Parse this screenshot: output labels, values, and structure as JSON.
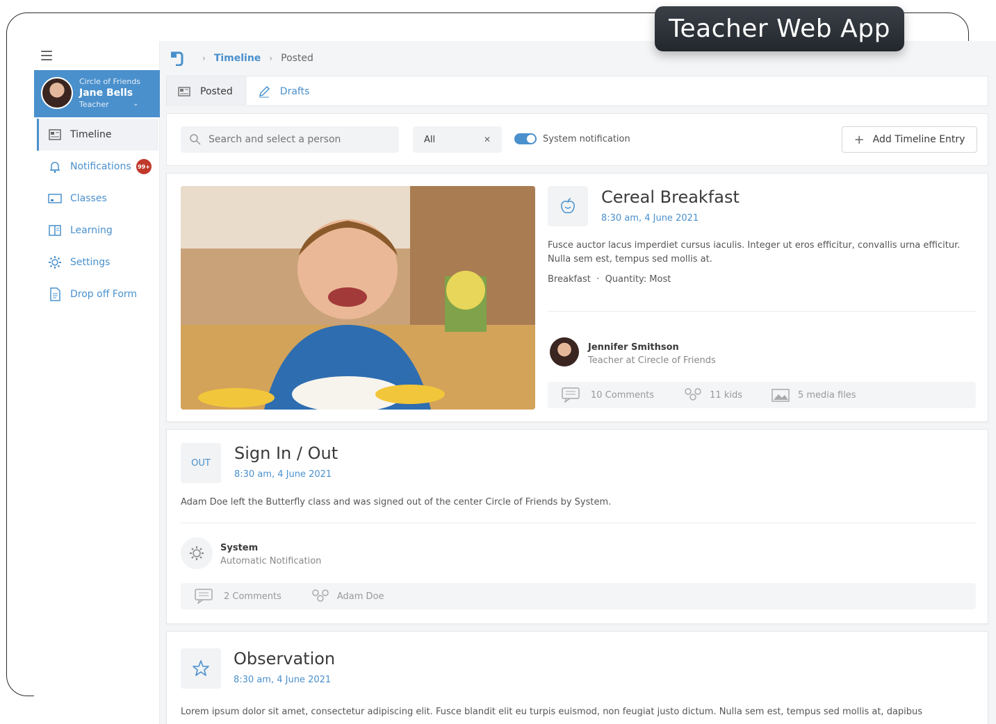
{
  "banner": {
    "title": "Teacher Web App"
  },
  "sidebar": {
    "profile": {
      "org": "Circle of Friends",
      "name": "Jane Bells",
      "role": "Teacher"
    },
    "items": [
      {
        "label": "Timeline",
        "icon": "timeline-icon"
      },
      {
        "label": "Notifications",
        "icon": "bell-icon",
        "badge": "99+"
      },
      {
        "label": "Classes",
        "icon": "classes-icon"
      },
      {
        "label": "Learning",
        "icon": "book-icon"
      },
      {
        "label": "Settings",
        "icon": "gear-icon"
      },
      {
        "label": "Drop off Form",
        "icon": "form-icon"
      }
    ]
  },
  "breadcrumb": {
    "parent": "Timeline",
    "current": "Posted"
  },
  "tabs": [
    {
      "label": "Posted",
      "icon": "newspaper-icon"
    },
    {
      "label": "Drafts",
      "icon": "pencil-icon"
    }
  ],
  "filters": {
    "search_placeholder": "Search and select a person",
    "select_value": "All",
    "toggle_label": "System notification",
    "add_label": "Add Timeline Entry"
  },
  "entries": [
    {
      "title": "Cereal Breakfast",
      "time": "8:30 am, 4 June 2021",
      "description": "Fusce auctor lacus imperdiet cursus iaculis. Integer ut eros efficitur, convallis urna efficitur. Nulla sem est, tempus sed mollis at.",
      "category": "Breakfast",
      "quantity": "Quantity: Most",
      "author_name": "Jennifer Smithson",
      "author_role": "Teacher at Cirecle of Friends",
      "comments": "10 Comments",
      "kids": "11 kids",
      "media": "5 media files"
    },
    {
      "badge": "OUT",
      "title": "Sign In / Out",
      "time": "8:30 am, 4 June 2021",
      "description": "Adam Doe left the Butterfly class and was signed out of the center Circle of Friends by System.",
      "author_name": "System",
      "author_role": "Automatic Notification",
      "comments": "2 Comments",
      "kids": "Adam Doe"
    },
    {
      "title": "Observation",
      "time": "8:30 am, 4 June 2021",
      "description": "Lorem ipsum dolor sit amet, consectetur adipiscing elit. Fusce blandit elit eu turpis euismod, non feugiat justo dictum. Nulla sem est, tempus sed mollis at, dapibus"
    }
  ],
  "colors": {
    "accent": "#4a90cc",
    "badge": "#c0392b"
  }
}
